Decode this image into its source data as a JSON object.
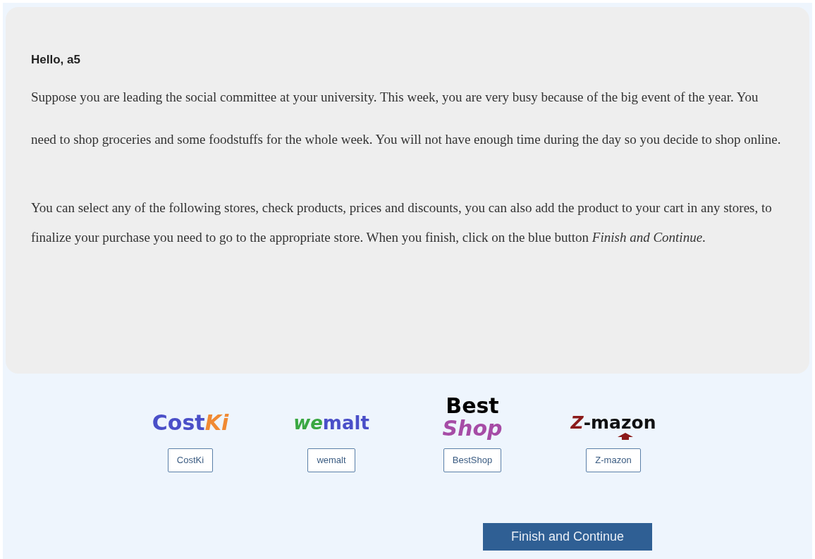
{
  "greeting": "Hello, a5",
  "paragraphs": [
    "Suppose you are leading the social committee at your university. This week, you are very busy because of the big event of the year. You need to shop groceries and some foodstuffs for the whole week. You will not have enough time during the day so you decide to shop online.",
    "You can select any of the following stores, check products, prices and discounts, you can also add the product to your cart in any stores, to finalize your purchase you need to go to the appropriate store. When you finish, click on the blue button *Finish and Continue*."
  ],
  "stores": [
    {
      "kind": "inline",
      "logo": [
        {
          "text": "Cost",
          "color": "#4a4fc8",
          "italic": false
        },
        {
          "text": "Ki",
          "color": "#f08a33",
          "italic": true
        }
      ],
      "button": "CostKi"
    },
    {
      "kind": "inline",
      "logo": [
        {
          "text": "we",
          "color": "#3aa843",
          "italic": true
        },
        {
          "text": "malt",
          "color": "#4a4fc8",
          "italic": false
        }
      ],
      "button": "wemalt"
    },
    {
      "kind": "stacked",
      "logo": [
        {
          "text": "Best",
          "color": "#000000",
          "italic": false
        },
        {
          "text": "Shop",
          "color": "#a64ca6",
          "italic": true
        }
      ],
      "button": "BestShop"
    },
    {
      "kind": "arrow",
      "logo": [
        {
          "text": "Z",
          "color": "#8b1a1a",
          "italic": true
        },
        {
          "text": "-mazon",
          "color": "#111111",
          "italic": false
        }
      ],
      "button": "Z-mazon"
    }
  ],
  "finish_button": "Finish and Continue"
}
